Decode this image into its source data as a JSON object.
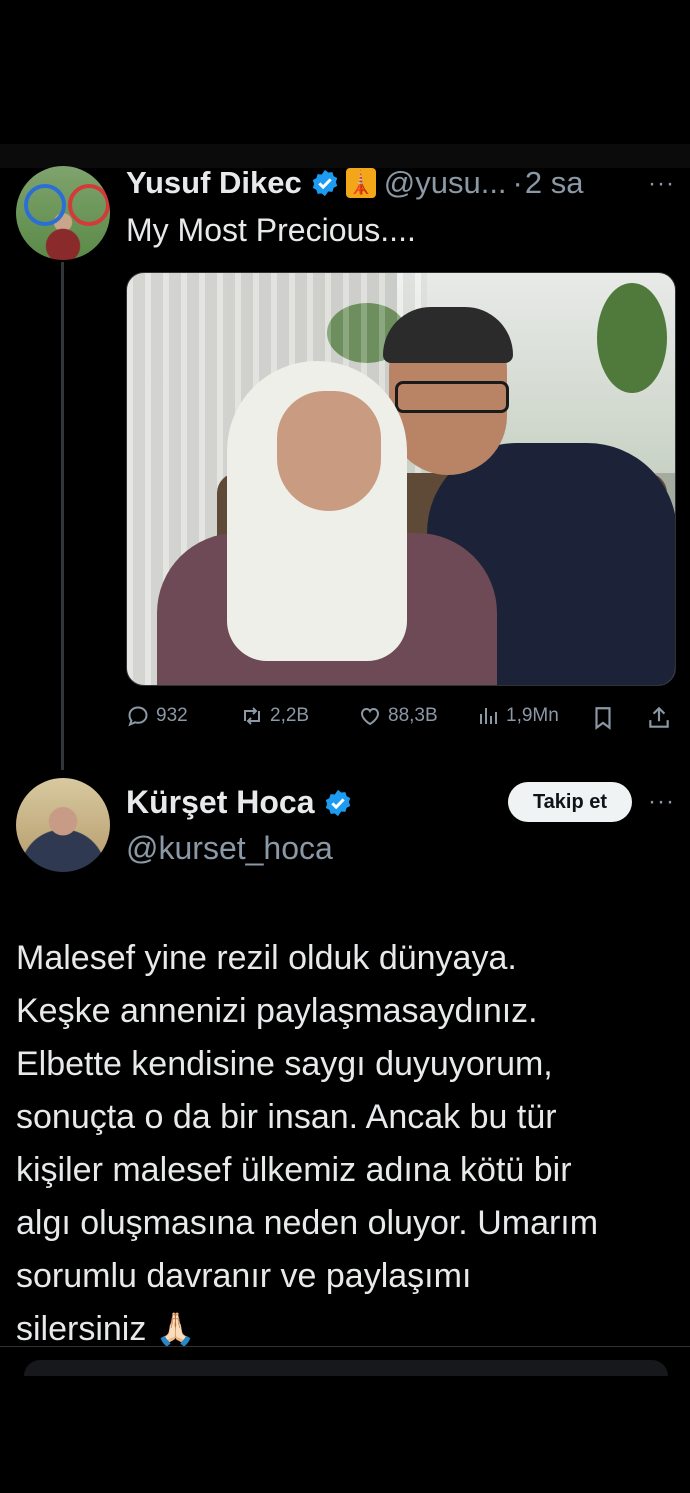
{
  "tweet1": {
    "author_name": "Yusuf Dikec",
    "badge_glyph": "🗼",
    "handle": "@yusu...",
    "separator": "·",
    "time": "2 sa",
    "more": "···",
    "text": "My Most Precious....",
    "actions": {
      "replies": "932",
      "reposts": "2,2B",
      "likes": "88,3B",
      "views": "1,9Mn"
    }
  },
  "tweet2": {
    "author_name": "Kürşet Hoca",
    "handle": "@kurset_hoca",
    "follow_label": "Takip et",
    "more": "···",
    "lines": [
      "Malesef yine rezil olduk dünyaya.",
      "Keşke annenizi paylaşmasaydınız.",
      "Elbette kendisine saygı duyuyorum,",
      "sonuçta o da bir insan. Ancak bu tür",
      "kişiler malesef ülkemiz adına kötü bir",
      "algı oluşmasına neden oluyor. Umarım",
      "sorumlu davranır ve paylaşımı",
      "silersiniz"
    ],
    "emoji": "🙏🏻"
  },
  "colors": {
    "background": "#000000",
    "text": "#e7e9ea",
    "secondary": "#8b98a5",
    "verified": "#1d9bf0"
  },
  "icons": [
    "reply-icon",
    "repost-icon",
    "like-icon",
    "views-icon",
    "bookmark-icon",
    "share-icon",
    "verified-icon",
    "more-icon"
  ]
}
